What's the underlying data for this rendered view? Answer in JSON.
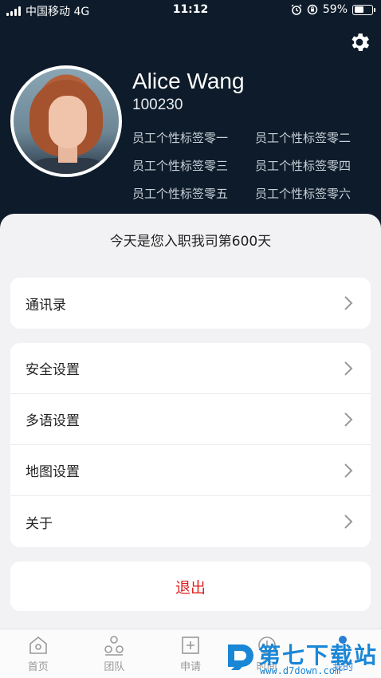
{
  "status_bar": {
    "carrier": "中国移动 4G",
    "time": "11:12",
    "battery_percent": "59%",
    "battery_level": 0.59
  },
  "profile": {
    "name": "Alice Wang",
    "employee_id": "100230",
    "tags": [
      "员工个性标签零一",
      "员工个性标签零二",
      "员工个性标签零三",
      "员工个性标签零四",
      "员工个性标签零五",
      "员工个性标签零六"
    ]
  },
  "days_message": "今天是您入职我司第600天",
  "menu": {
    "contacts": "通讯录",
    "security": "安全设置",
    "language": "多语设置",
    "map": "地图设置",
    "about": "关于"
  },
  "logout_label": "退出",
  "tabs": [
    {
      "label": "首页",
      "icon": "home-icon"
    },
    {
      "label": "团队",
      "icon": "team-icon"
    },
    {
      "label": "申请",
      "icon": "apply-icon"
    },
    {
      "label": "时间",
      "icon": "clock-icon"
    },
    {
      "label": "我的",
      "icon": "profile-icon"
    }
  ],
  "colors": {
    "header_bg": "#0d1b2a",
    "logout_red": "#e02424",
    "active_tab": "#2a7fd4"
  },
  "watermark": {
    "text": "第七下载站",
    "url": "www.d7down.com"
  }
}
